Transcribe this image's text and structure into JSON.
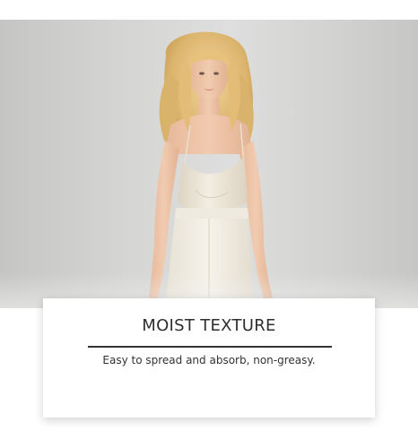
{
  "feature": {
    "title": "MOIST TEXTURE",
    "description": "Easy to spread and absorb, non-greasy."
  },
  "photo": {
    "background_color": "#d8d8d6",
    "garment_color": "#efe9dc"
  }
}
